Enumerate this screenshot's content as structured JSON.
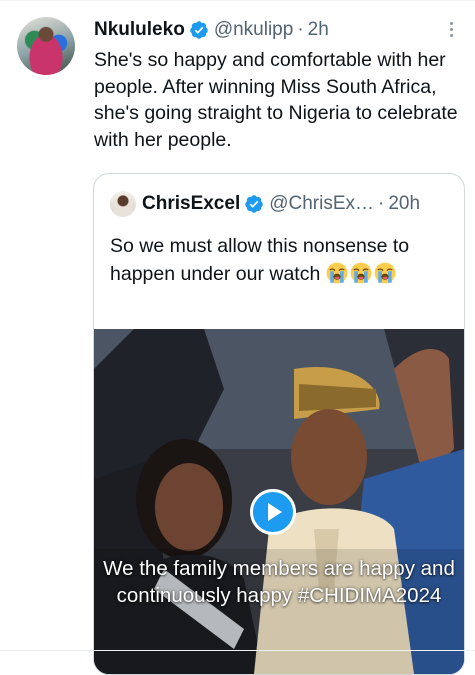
{
  "tweet": {
    "author_name": "Nkululeko",
    "handle": "@nkulipp",
    "separator": "·",
    "time": "2h",
    "text": "She's so happy and comfortable with her people. After winning Miss South Africa, she's going straight to Nigeria to celebrate with her people."
  },
  "quote": {
    "author_name": "ChrisExcel",
    "handle": "@ChrisEx…",
    "separator": "·",
    "time": "20h",
    "text": "So we must allow this nonsense to happen under our watch",
    "emojis": [
      "loudly-crying-face",
      "loudly-crying-face",
      "loudly-crying-face"
    ],
    "video": {
      "caption": "We the family members are happy and continuously happy #CHIDIMA2024"
    }
  },
  "colors": {
    "verified_blue": "#1d9bf0",
    "text": "#0f1419",
    "muted": "#536471",
    "border": "#cfd9de"
  }
}
